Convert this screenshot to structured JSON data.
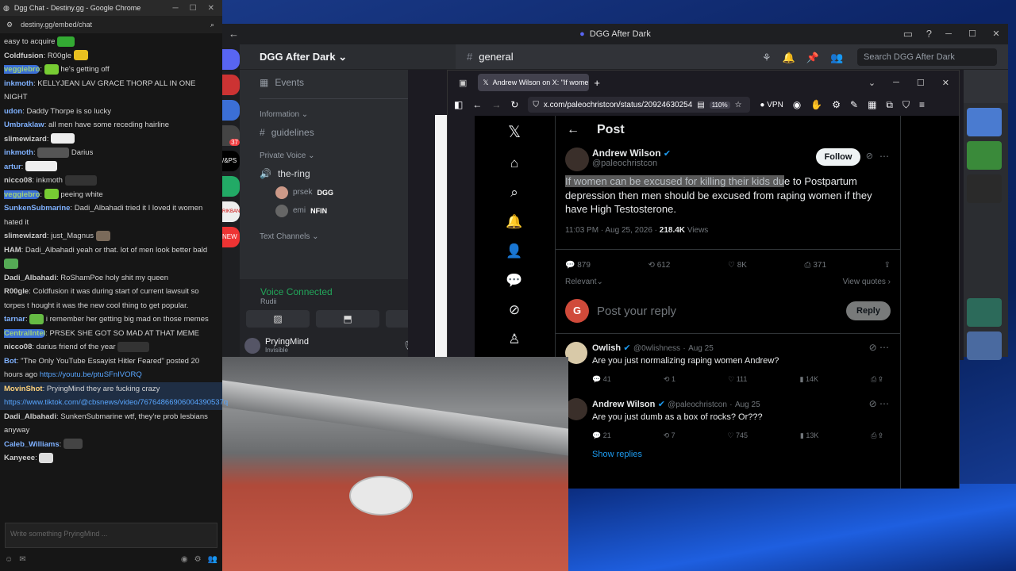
{
  "chat": {
    "window_title": "Dgg Chat - Destiny.gg - Google Chrome",
    "address": "destiny.gg/embed/chat",
    "messages": [
      {
        "user": "",
        "text": "easy to acquire"
      },
      {
        "user": "Coldfusion",
        "text": "R00gle"
      },
      {
        "user": "veggiebro",
        "text": "he's getting off"
      },
      {
        "user": "inkmoth",
        "text": "KELLYJEAN LAV GRACE THORP ALL IN ONE NIGHT"
      },
      {
        "user": "udon",
        "text": "Daddy Thorpe is so lucky"
      },
      {
        "user": "Umbraklaw",
        "text": "all men have some receding hairline"
      },
      {
        "user": "slimewizard",
        "text": ""
      },
      {
        "user": "inkmoth",
        "text": "Darius"
      },
      {
        "user": "artur",
        "text": ""
      },
      {
        "user": "nicco08",
        "text": "inkmoth"
      },
      {
        "user": "veggiebro",
        "text": "peeing white"
      },
      {
        "user": "SunkenSubmarine",
        "text": "Dadi_Albahadi tried it   I loved it   women hated it"
      },
      {
        "user": "slimewizard",
        "text": "just_Magnus"
      },
      {
        "user": "HAM",
        "text": "Dadi_Albahadi yeah or that. lot of men look better bald"
      },
      {
        "user": "Dadi_Albahadi",
        "text": "RoShamPoe holy shit my queen"
      },
      {
        "user": "R00gle",
        "text": "Coldfusion it was during start of current lawsuit so torpes t hought it was the new cool thing to get popular."
      },
      {
        "user": "tarnar",
        "text": "i remember her getting big mad on those memes"
      },
      {
        "user": "CentralIntel",
        "text": "PRSEK SHE GOT SO MAD AT THAT MEME"
      },
      {
        "user": "nicco08",
        "text": "darius friend of the year"
      },
      {
        "user": "Bot",
        "text": "\"The Only YouTube Essayist Hitler Feared\" posted 20 hours ago",
        "link": "https://youtu.be/ptuSFnIVORQ"
      },
      {
        "user": "MovinShot",
        "text": "PryingMind they are fucking crazy",
        "link": "https://www.tiktok.com/@cbsnews/video/76764866906004390537q"
      },
      {
        "user": "Dadi_Albahadi",
        "text": "SunkenSubmarine wtf, they're prob lesbians anyway"
      },
      {
        "user": "Caleb_Williams",
        "text": ""
      },
      {
        "user": "Kanyeee",
        "text": ""
      }
    ],
    "input_placeholder": "Write something PryingMind ..."
  },
  "discord": {
    "window_title": "DGG After Dark",
    "server_name": "DGG After Dark",
    "channel": "general",
    "search_placeholder": "Search DGG After Dark",
    "events_label": "Events",
    "information_label": "Information",
    "guidelines_label": "guidelines",
    "private_voice_label": "Private Voice",
    "the_ring_label": "the-ring",
    "voice_users": [
      {
        "name": "prsek",
        "tag": "DGG"
      },
      {
        "name": "emi",
        "tag": "NFIN"
      }
    ],
    "text_channels_label": "Text Channels",
    "voice_connected": "Voice Connected",
    "voice_sub": "Rudii",
    "user_name": "PryingMind",
    "user_status": "Invisible",
    "guild_badge": "37",
    "guild_labels": [
      "/&PS",
      "RIKBANG",
      "NEW"
    ]
  },
  "browser": {
    "tab_title": "Andrew Wilson on X: \"If women",
    "url": "x.com/paleochristcon/status/20924630254",
    "zoom": "110%",
    "vpn_label": "VPN"
  },
  "post": {
    "header": "Post",
    "author_name": "Andrew Wilson",
    "author_handle": "@paleochristcon",
    "follow_label": "Follow",
    "text_highlighted": "If women can be excused for killing their kids du",
    "text_rest": "e to Postpartum depression then men should be excused from raping women if they have High Testosterone.",
    "time": "11:03 PM · Aug 25, 2026 · ",
    "views": "218.4K",
    "views_label": "Views",
    "replies": "879",
    "reposts": "612",
    "likes": "8K",
    "bookmarks": "371",
    "relevant_label": "Relevant",
    "view_quotes_label": "View quotes",
    "reply_placeholder": "Post your reply",
    "reply_button": "Reply",
    "reply_avatar_letter": "G"
  },
  "replies": [
    {
      "name": "Owlish",
      "handle": "@0wlishness",
      "date": "Aug 25",
      "text": "Are you just normalizing raping women Andrew?",
      "replies": "41",
      "reposts": "1",
      "likes": "111",
      "views": "14K"
    },
    {
      "name": "Andrew Wilson",
      "handle": "@paleochristcon",
      "date": "Aug 25",
      "text": "Are you just dumb as a box of rocks? Or???",
      "replies": "21",
      "reposts": "7",
      "likes": "745",
      "views": "13K"
    }
  ],
  "show_replies_label": "Show replies",
  "colors": {
    "accent_blue": "#1d9bf0",
    "discord_green": "#23a55a",
    "x_bg": "#000000"
  }
}
